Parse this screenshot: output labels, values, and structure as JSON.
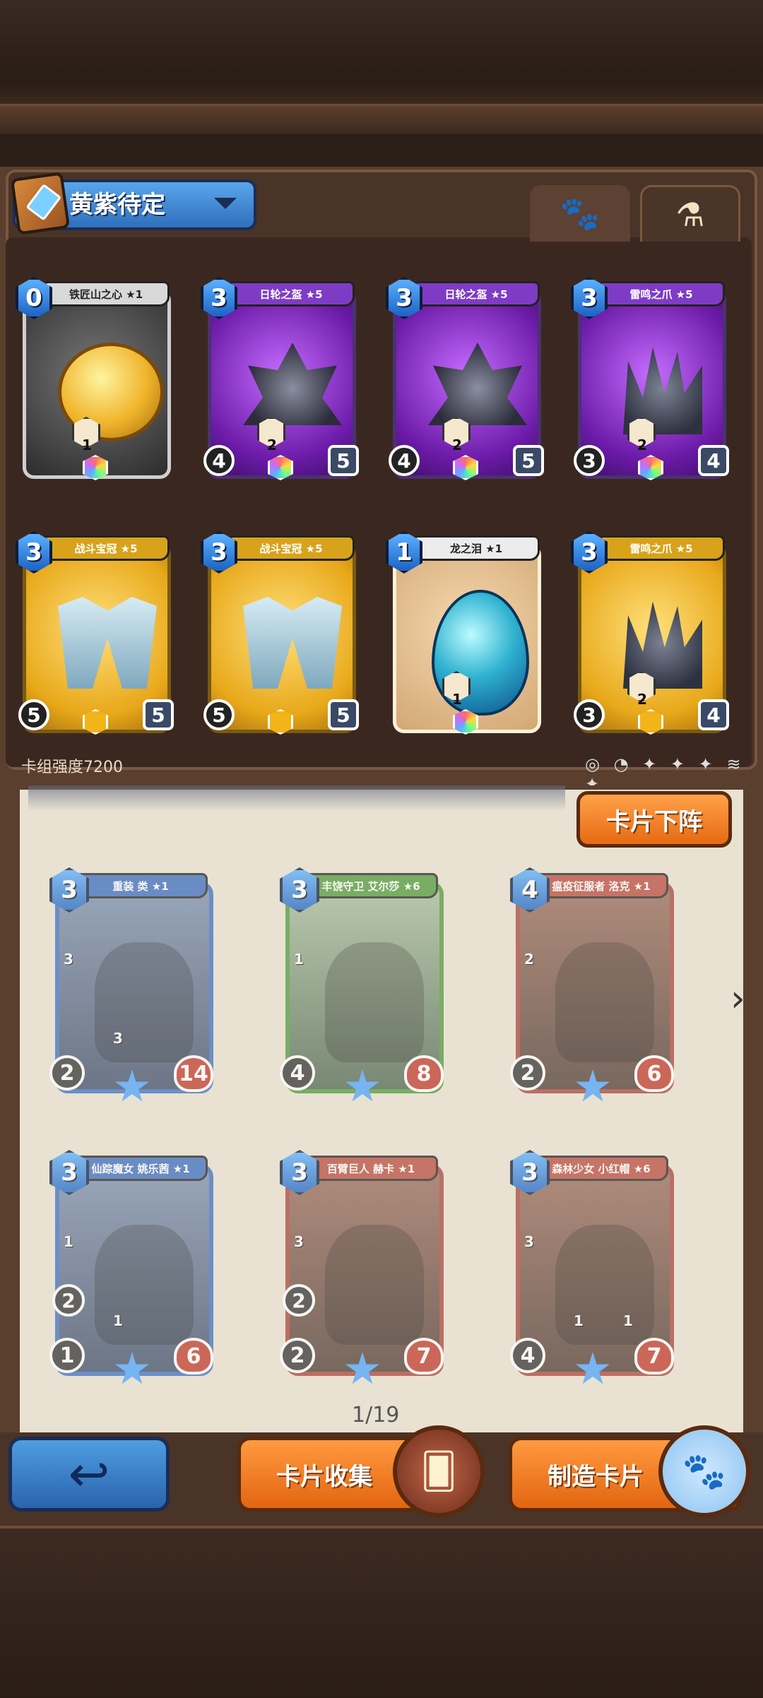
{
  "deck": {
    "name": "黄紫待定",
    "tabs": [
      "paw-icon",
      "flask-icon"
    ],
    "strength_label": "卡组强度7200",
    "filter_icons": "◎ ◔ ✦ ✦ ✦ ≋ ✦"
  },
  "deck_cards": [
    {
      "cost": "0",
      "name": "铁匠山之心 ★1",
      "rarity": "gray",
      "art": "coin",
      "left": "",
      "right": "",
      "trait_counts": [
        "1"
      ]
    },
    {
      "cost": "3",
      "name": "日轮之盔 ★5",
      "rarity": "purple",
      "art": "helm",
      "left": "4",
      "right": "5",
      "trait_counts": [
        "2"
      ]
    },
    {
      "cost": "3",
      "name": "日轮之盔 ★5",
      "rarity": "purple",
      "art": "helm",
      "left": "4",
      "right": "5",
      "trait_counts": [
        "2"
      ]
    },
    {
      "cost": "3",
      "name": "雷鸣之爪 ★5",
      "rarity": "purple",
      "art": "claw",
      "left": "3",
      "right": "4",
      "trait_counts": [
        "2"
      ]
    },
    {
      "cost": "3",
      "name": "战斗宝冠 ★5",
      "rarity": "gold",
      "art": "crown",
      "left": "5",
      "right": "5",
      "trait_counts": []
    },
    {
      "cost": "3",
      "name": "战斗宝冠 ★5",
      "rarity": "gold",
      "art": "crown",
      "left": "5",
      "right": "5",
      "trait_counts": []
    },
    {
      "cost": "1",
      "name": "龙之泪 ★1",
      "rarity": "tan",
      "art": "egg",
      "left": "",
      "right": "",
      "trait_counts": [
        "1"
      ]
    },
    {
      "cost": "3",
      "name": "雷鸣之爪 ★5",
      "rarity": "gold",
      "art": "claw",
      "left": "3",
      "right": "4",
      "trait_counts": [
        "2"
      ]
    }
  ],
  "remove_button": "卡片下阵",
  "collection": [
    {
      "cost": "3",
      "name": "重装 类 ★1",
      "frame": "blue",
      "s0": "",
      "attack": "2",
      "hp": "14",
      "trait_counts": [
        "3",
        "3"
      ]
    },
    {
      "cost": "3",
      "name": "丰饶守卫 艾尔莎 ★6",
      "frame": "green",
      "s0": "",
      "attack": "4",
      "hp": "8",
      "trait_counts": [
        "1"
      ]
    },
    {
      "cost": "4",
      "name": "瘟疫征服者 洛克 ★1",
      "frame": "red",
      "s0": "",
      "attack": "2",
      "hp": "6",
      "trait_counts": [
        "2"
      ]
    },
    {
      "cost": "3",
      "name": "仙踪魔女 姚乐茜 ★1",
      "frame": "blue",
      "s0": "2",
      "attack": "1",
      "hp": "6",
      "trait_counts": [
        "1",
        "1"
      ]
    },
    {
      "cost": "3",
      "name": "百臂巨人 赫卡 ★1",
      "frame": "red",
      "s0": "2",
      "attack": "2",
      "hp": "7",
      "trait_counts": [
        "3"
      ]
    },
    {
      "cost": "3",
      "name": "森林少女 小红帽 ★6",
      "frame": "red",
      "s0": "",
      "attack": "4",
      "hp": "7",
      "trait_counts": [
        "3",
        "1",
        "1"
      ]
    }
  ],
  "page": "1/19",
  "footer": {
    "back": "↩",
    "collect": "卡片收集",
    "craft": "制造卡片"
  }
}
